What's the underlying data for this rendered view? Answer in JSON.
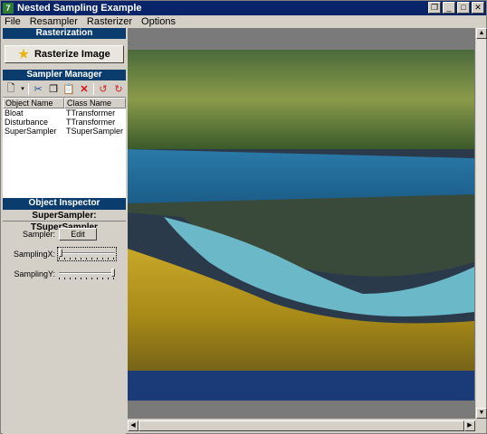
{
  "window": {
    "title": "Nested Sampling Example",
    "app_icon": "delphi-app-icon",
    "buttons": [
      "restore-icon",
      "minimize-icon",
      "maximize-icon",
      "close-icon"
    ]
  },
  "menu": [
    "File",
    "Resampler",
    "Rasterizer",
    "Options"
  ],
  "rasterization": {
    "header": "Rasterization",
    "button_label": "Rasterize Image",
    "button_icon": "star-icon"
  },
  "sampler_manager": {
    "header": "Sampler Manager",
    "toolbar": [
      "new-icon",
      "dropdown-icon",
      "cut-icon",
      "copy-icon",
      "paste-icon",
      "delete-icon",
      "undo-icon",
      "redo-icon"
    ],
    "columns": [
      "Object Name",
      "Class Name"
    ],
    "rows": [
      {
        "name": "Bloat",
        "class": "TTransformer"
      },
      {
        "name": "Disturbance",
        "class": "TTransformer"
      },
      {
        "name": "SuperSampler",
        "class": "TSuperSampler"
      }
    ]
  },
  "object_inspector": {
    "header": "Object Inspector",
    "title": "SuperSampler: TSuperSampler",
    "sampler_label": "Sampler:",
    "edit_label": "Edit",
    "sampling_x_label": "SamplingX:",
    "sampling_x_value": 0,
    "sampling_y_label": "SamplingY:",
    "sampling_y_value": 1
  },
  "colors": {
    "title_bar": "#0a246a",
    "panel_header": "#0a3c6e",
    "window_face": "#d4d0c8"
  }
}
